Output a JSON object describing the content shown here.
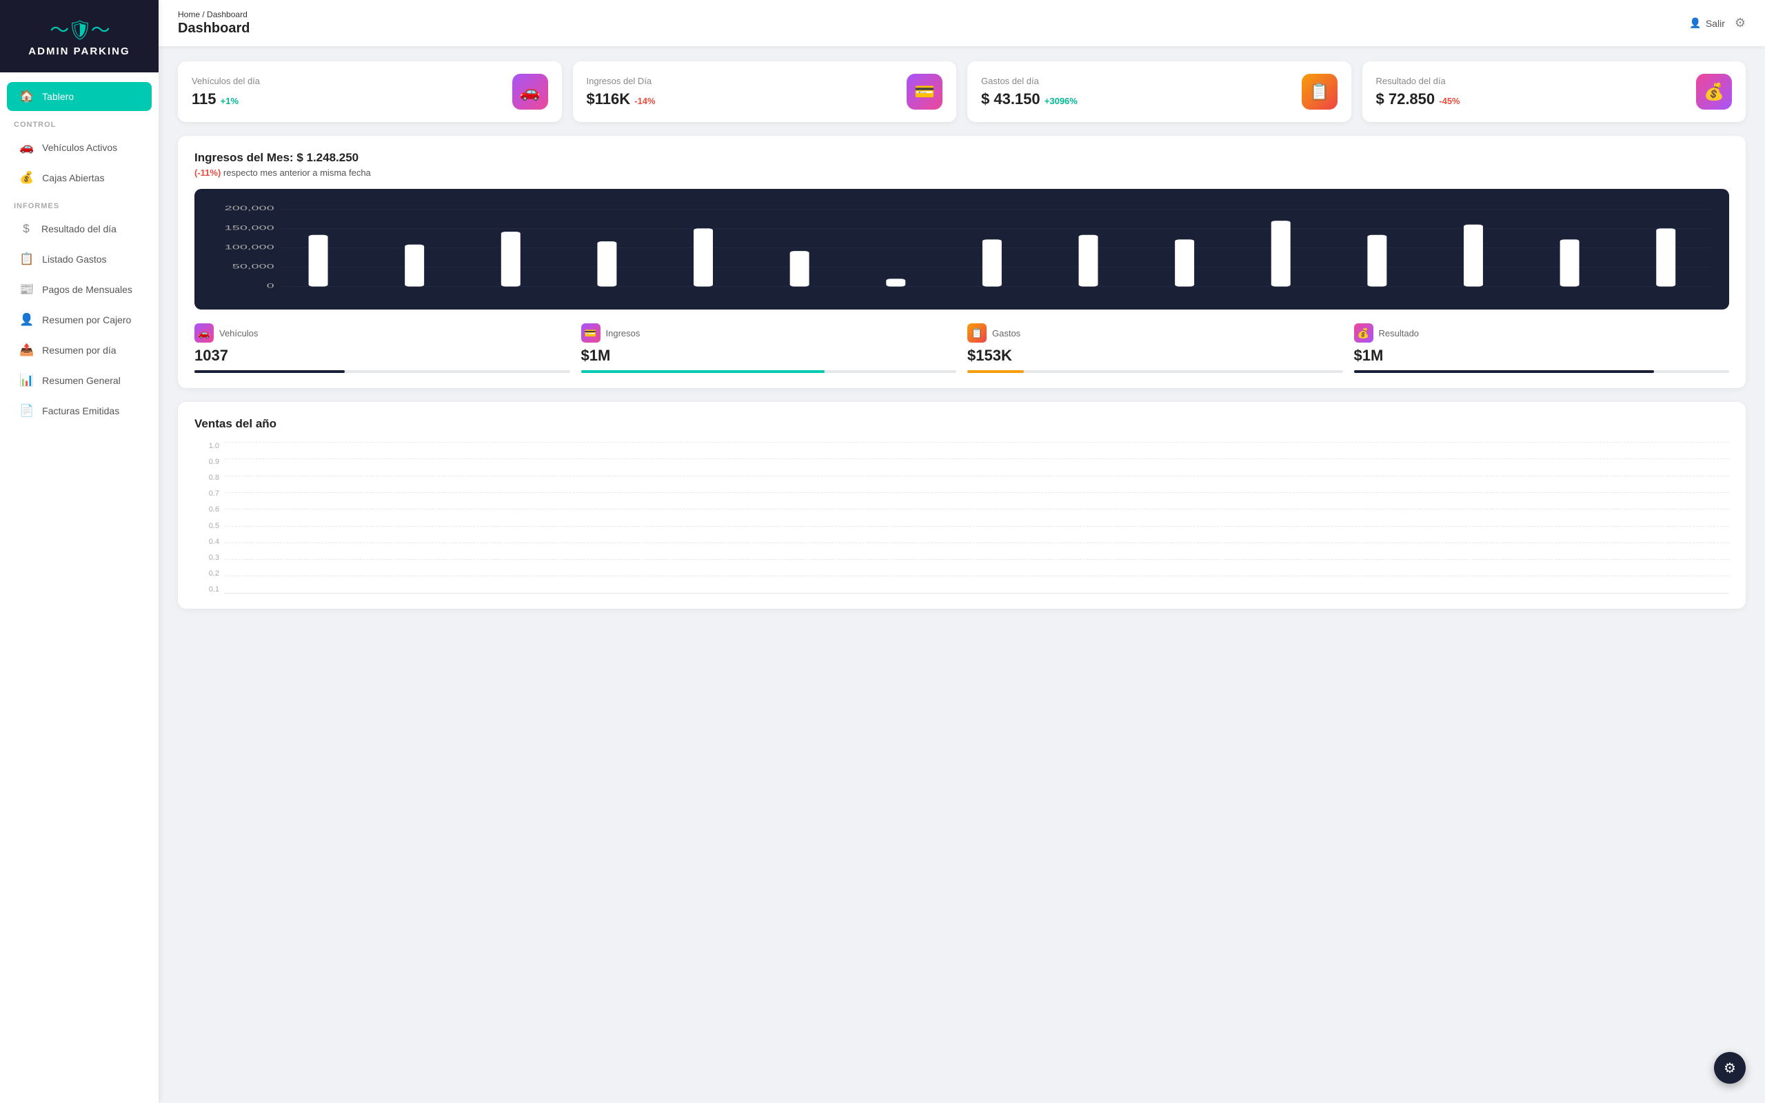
{
  "app": {
    "name": "ADMIN PARKING",
    "logo_symbol": "🛡"
  },
  "topbar": {
    "breadcrumb_home": "Home",
    "breadcrumb_separator": "/",
    "breadcrumb_current": "Dashboard",
    "page_title": "Dashboard",
    "salir_label": "Salir"
  },
  "sidebar": {
    "section_control": "CONTROL",
    "section_informes": "INFORMES",
    "items": [
      {
        "id": "tablero",
        "label": "Tablero",
        "icon": "🏠",
        "active": true
      },
      {
        "id": "vehiculos-activos",
        "label": "Vehículos Activos",
        "icon": "🚗",
        "active": false
      },
      {
        "id": "cajas-abiertas",
        "label": "Cajas Abiertas",
        "icon": "💰",
        "active": false
      },
      {
        "id": "resultado-dia",
        "label": "Resultado del día",
        "icon": "$",
        "active": false
      },
      {
        "id": "listado-gastos",
        "label": "Listado Gastos",
        "icon": "📋",
        "active": false
      },
      {
        "id": "pagos-mensuales",
        "label": "Pagos de Mensuales",
        "icon": "📰",
        "active": false
      },
      {
        "id": "resumen-cajero",
        "label": "Resumen por Cajero",
        "icon": "👤",
        "active": false
      },
      {
        "id": "resumen-dia",
        "label": "Resumen por día",
        "icon": "📤",
        "active": false
      },
      {
        "id": "resumen-general",
        "label": "Resumen General",
        "icon": "📊",
        "active": false
      },
      {
        "id": "facturas-emitidas",
        "label": "Facturas Emitidas",
        "icon": "📄",
        "active": false
      }
    ]
  },
  "stat_cards": [
    {
      "label": "Vehículos del día",
      "value": "115",
      "change": "+1%",
      "change_type": "pos",
      "icon": "🚗",
      "icon_class": "icon-teal"
    },
    {
      "label": "Ingresos del Día",
      "value": "$116K",
      "change": "-14%",
      "change_type": "neg",
      "icon": "💳",
      "icon_class": "icon-purple"
    },
    {
      "label": "Gastos del día",
      "value": "$ 43.150",
      "change": "+3096%",
      "change_type": "pos",
      "icon": "📋",
      "icon_class": "icon-orange"
    },
    {
      "label": "Resultado del día",
      "value": "$ 72.850",
      "change": "-45%",
      "change_type": "neg",
      "icon": "💰",
      "icon_class": "icon-pink"
    }
  ],
  "monthly": {
    "title": "Ingresos del Mes: $ 1.248.250",
    "subtitle_neg": "(-11%)",
    "subtitle_rest": " respecto mes anterior a misma fecha",
    "chart_bars": [
      85,
      65,
      90,
      70,
      95,
      45,
      10,
      75,
      85,
      75,
      110,
      85,
      100,
      75,
      95
    ],
    "chart_y_labels": [
      "200,000",
      "150,000",
      "100,000",
      "50,000",
      "0"
    ],
    "stats": [
      {
        "label": "Vehículos",
        "value": "1037",
        "icon": "🚗",
        "icon_class": "icon-teal",
        "bar_pct": 40,
        "bar_color": "#1a2035"
      },
      {
        "label": "Ingresos",
        "value": "$1M",
        "icon": "💳",
        "icon_class": "icon-purple",
        "bar_pct": 65,
        "bar_color": "#1a2035"
      },
      {
        "label": "Gastos",
        "value": "$153K",
        "icon": "📋",
        "icon_class": "icon-orange",
        "bar_pct": 15,
        "bar_color": "#f59e0b"
      },
      {
        "label": "Resultado",
        "value": "$1M",
        "icon": "💰",
        "icon_class": "icon-pink",
        "bar_pct": 80,
        "bar_color": "#1a2035"
      }
    ]
  },
  "sales_year": {
    "title": "Ventas del año",
    "y_labels": [
      "1.0",
      "0.9",
      "0.8",
      "0.7",
      "0.6",
      "0.5",
      "0.4",
      "0.3",
      "0.2",
      "0.1"
    ]
  }
}
